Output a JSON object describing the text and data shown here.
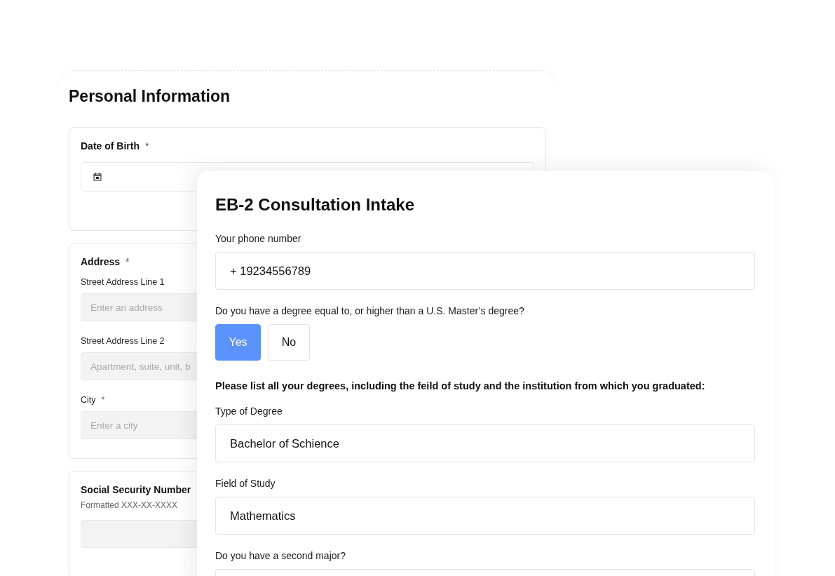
{
  "back_form": {
    "title": "Personal Information",
    "sections": [
      {
        "kind": "date",
        "label": "Date of Birth",
        "required_mark": "*"
      },
      {
        "kind": "address",
        "label": "Address",
        "required_mark": "*",
        "fields": [
          {
            "label": "Street Address Line 1",
            "placeholder": "Enter an address"
          },
          {
            "label": "Street Address Line 2",
            "placeholder": "Apartment, suite, unit, b"
          },
          {
            "label": "City",
            "required_mark": "*",
            "placeholder": "Enter a city"
          }
        ]
      },
      {
        "kind": "ssn",
        "label": "Social Security Number",
        "hint": "Formatted XXX-XX-XXXX"
      }
    ]
  },
  "intake_form": {
    "title": "EB-2 Consultation Intake",
    "items": [
      {
        "kind": "text",
        "label": "Your phone number",
        "value": "+ 19234556789"
      },
      {
        "kind": "choice",
        "label": "Do you have a degree equal to, or higher than a U.S. Master’s degree?",
        "options": [
          {
            "label": "Yes",
            "selected": true
          },
          {
            "label": "No",
            "selected": false
          }
        ]
      },
      {
        "kind": "heading",
        "text": "Please list all your degrees, including the feild of study and the institution from which you graduated:"
      },
      {
        "kind": "text",
        "label": "Type of Degree",
        "value": "Bachelor of Schience"
      },
      {
        "kind": "text",
        "label": "Field of Study",
        "value": "Mathematics"
      },
      {
        "kind": "text",
        "label": "Do you have a second major?"
      }
    ]
  }
}
